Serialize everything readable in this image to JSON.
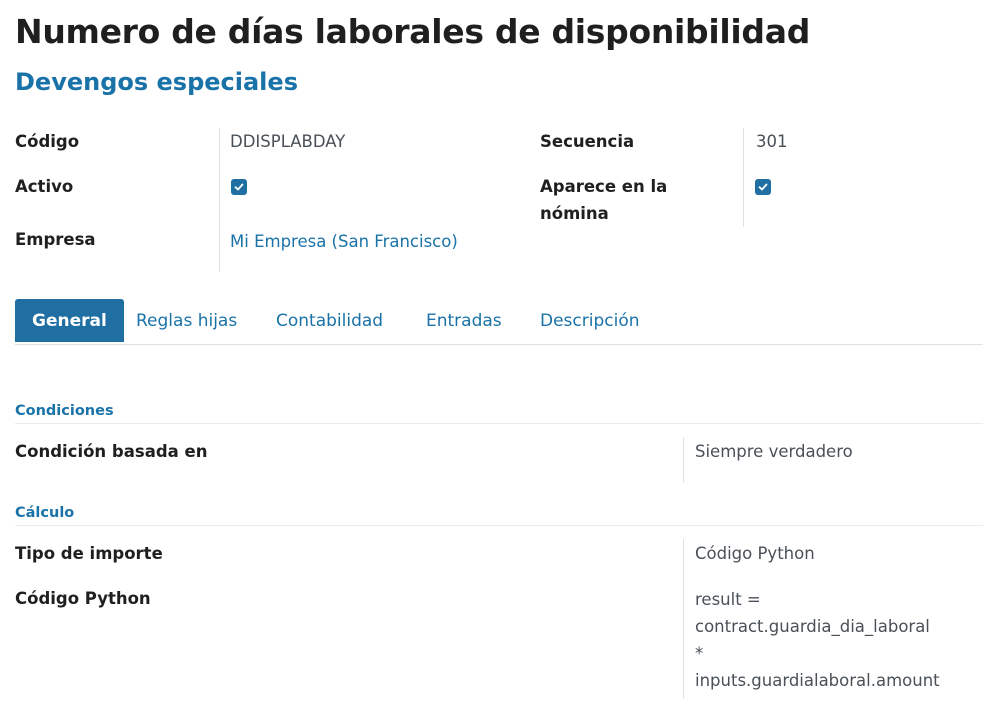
{
  "header": {
    "title": "Numero de días laborales de disponibilidad",
    "category": "Devengos especiales"
  },
  "fields": {
    "codigo_label": "Código",
    "codigo_value": "DDISPLABDAY",
    "activo_label": "Activo",
    "activo_checked": true,
    "empresa_label": "Empresa",
    "empresa_value": "Mi Empresa (San Francisco)",
    "secuencia_label": "Secuencia",
    "secuencia_value": "301",
    "aparece_label_line1": "Aparece en la",
    "aparece_label_line2": "nómina",
    "aparece_checked": true
  },
  "tabs": [
    {
      "label": "General",
      "active": true
    },
    {
      "label": "Reglas hijas",
      "active": false
    },
    {
      "label": "Contabilidad",
      "active": false
    },
    {
      "label": "Entradas",
      "active": false
    },
    {
      "label": "Descripción",
      "active": false
    }
  ],
  "general": {
    "conditions": {
      "section_title": "Condiciones",
      "condition_label": "Condición basada en",
      "condition_value": "Siempre verdadero"
    },
    "computation": {
      "section_title": "Cálculo",
      "amount_type_label": "Tipo de importe",
      "amount_type_value": "Código Python",
      "python_code_label": "Código Python",
      "python_code_lines": [
        "result =",
        "contract.guardia_dia_laboral",
        "*",
        "inputs.guardialaboral.amount"
      ]
    }
  },
  "colors": {
    "accent": "#1f6fa3",
    "link": "#1a73a8"
  }
}
